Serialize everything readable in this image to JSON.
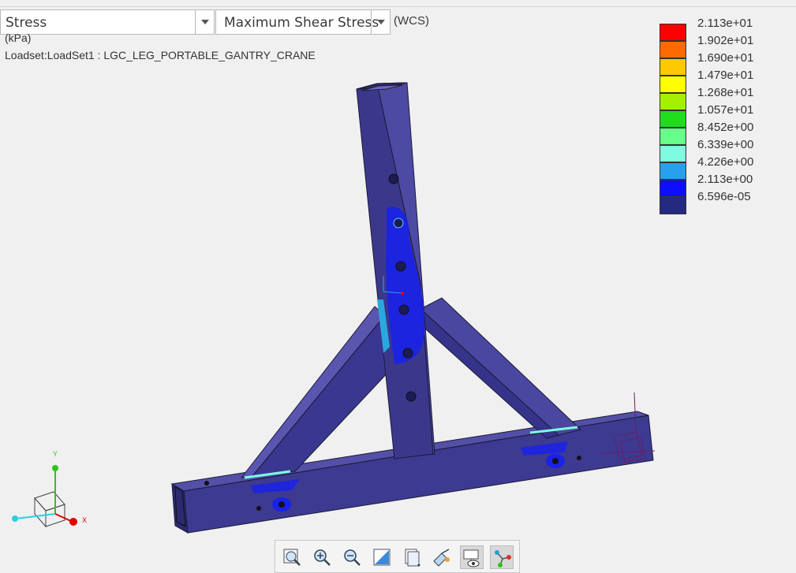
{
  "toolbar_top": {
    "quantity_dropdown": {
      "value": "Stress"
    },
    "component_dropdown": {
      "value": "Maximum Shear Stress"
    },
    "csys_label": "(WCS)"
  },
  "result_info": {
    "units": "(kPa)",
    "loadset": "Loadset:LoadSet1 :  LGC_LEG_PORTABLE_GANTRY_CRANE"
  },
  "legend": {
    "entries": [
      {
        "value": "2.113e+01",
        "color": "#ff0000"
      },
      {
        "value": "1.902e+01",
        "color": "#ff6a00"
      },
      {
        "value": "1.690e+01",
        "color": "#ffc800"
      },
      {
        "value": "1.479e+01",
        "color": "#ffff00"
      },
      {
        "value": "1.268e+01",
        "color": "#a4f000"
      },
      {
        "value": "1.057e+01",
        "color": "#1fdc1f"
      },
      {
        "value": "8.452e+00",
        "color": "#66ff88"
      },
      {
        "value": "6.339e+00",
        "color": "#7ffce0"
      },
      {
        "value": "4.226e+00",
        "color": "#27a0f0"
      },
      {
        "value": "2.113e+00",
        "color": "#0e0eff"
      },
      {
        "value": "6.596e-05",
        "color": "#232a80"
      }
    ]
  },
  "triad": {
    "y_label": "Y",
    "x_label": "X"
  },
  "view_toolbar": {
    "buttons": [
      {
        "name": "refit-icon"
      },
      {
        "name": "zoom-in-icon"
      },
      {
        "name": "zoom-out-icon"
      },
      {
        "name": "repaint-icon"
      },
      {
        "name": "saved-views-icon"
      },
      {
        "name": "view-manager-icon"
      },
      {
        "name": "display-style-icon"
      },
      {
        "name": "datum-display-icon"
      }
    ]
  }
}
